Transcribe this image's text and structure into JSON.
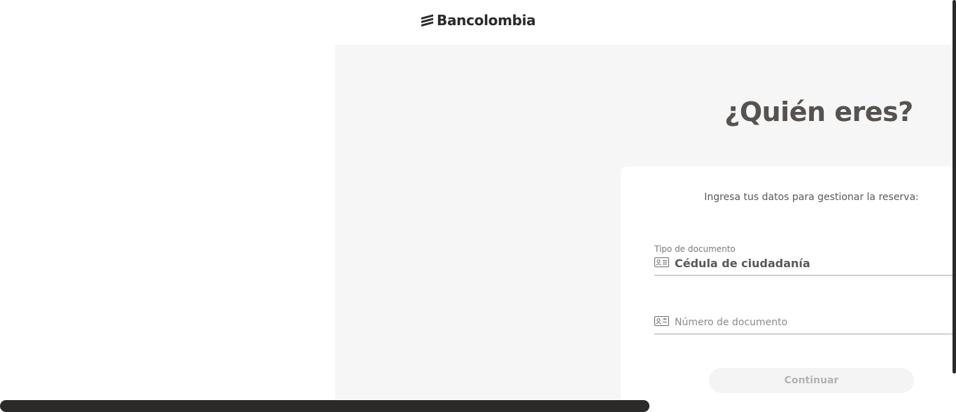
{
  "header": {
    "brand_name": "Bancolombia",
    "logo_icon": "bancolombia-stripes-icon"
  },
  "main": {
    "title": "¿Quién eres?",
    "background_color": "#f6f6f6"
  },
  "form": {
    "subtitle": "Ingresa tus datos para gestionar la reserva:",
    "document_type": {
      "label": "Tipo de documento",
      "value": "Cédula de ciudadanía",
      "icon": "id-card-icon"
    },
    "document_number": {
      "placeholder": "Número de documento",
      "value": "",
      "icon": "id-card-icon"
    },
    "continue_button": {
      "label": "Continuar",
      "enabled": false
    }
  },
  "colors": {
    "text_dark": "#2c2a29",
    "text_muted": "#595959",
    "button_disabled_bg": "#f4f4f4",
    "button_disabled_text": "#b3b3b3"
  }
}
